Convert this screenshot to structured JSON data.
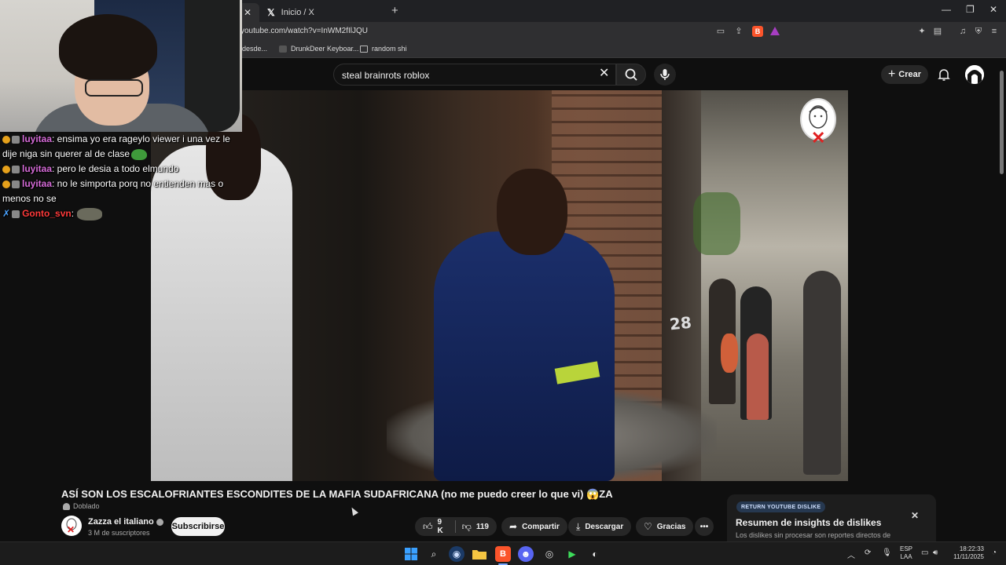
{
  "browser": {
    "tabs": [
      {
        "label": "",
        "active": true
      },
      {
        "label": "Inicio / X",
        "active": false
      }
    ],
    "url": "youtube.com/watch?v=InWM2fIlJQU",
    "bookmarks": [
      "desde...",
      "DrunkDeer Keyboar...",
      "random shi"
    ]
  },
  "youtube": {
    "search_query": "steal brainrots roblox",
    "create_label": "Crear"
  },
  "chat": [
    {
      "user": "luyitaa",
      "message": ": ensima yo era rageylo viewer i una vez le dije niga sin querer al de clase",
      "emote": "frog"
    },
    {
      "user": "luyitaa",
      "message": ": pero le desia a todo elmundo",
      "emote": ""
    },
    {
      "user": "luyitaa",
      "message": ": no le simporta porq no entienden mas o menos no se",
      "emote": ""
    },
    {
      "user": "Gonto_svn",
      "message": ":",
      "emote": "cat"
    }
  ],
  "video": {
    "overlay_number": "28",
    "title": "ASÍ SON LOS ESCALOFRIANTES ESCONDITES DE LA MAFIA SUDAFRICANA (no me puedo creer lo que vi) 😱ZA",
    "dubbed_label": "Doblado",
    "channel_name": "Zazza el italiano",
    "subscribers": "3 M de suscriptores",
    "subscribe_label": "Subscribirse",
    "likes": "9 K",
    "dislikes": "119",
    "share_label": "Compartir",
    "download_label": "Descargar",
    "thanks_label": "Gracias"
  },
  "ryd": {
    "tag": "RETURN YOUTUBE DISLIKE",
    "title": "Resumen de insights de dislikes",
    "description": "Los dislikes sin procesar son reportes directos de"
  },
  "taskbar": {
    "lang_top": "ESP",
    "lang_bottom": "LAA",
    "time": "18:22:33",
    "date": "11/11/2025"
  },
  "colors": {
    "accent_brave": "#fb542b",
    "chat_user": "#d66bd8",
    "chat_user_red": "#ff3a3a",
    "background": "#0f0f0f"
  }
}
